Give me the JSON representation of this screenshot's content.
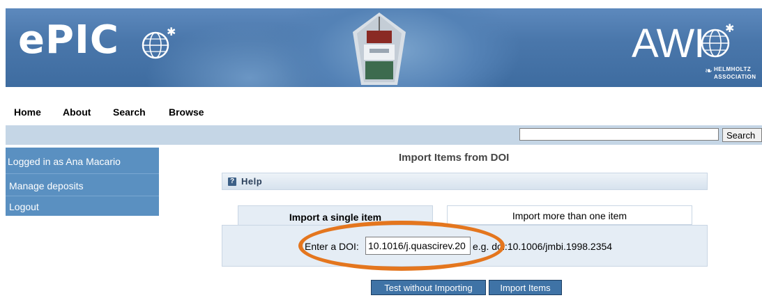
{
  "header": {
    "logo_left": "ePIC",
    "logo_right": "AWI",
    "association_line1": "HELMHOLTZ",
    "association_line2": "ASSOCIATION"
  },
  "nav": {
    "items": [
      "Home",
      "About",
      "Search",
      "Browse"
    ]
  },
  "search": {
    "value": "",
    "button_label": "Search"
  },
  "sidebar": {
    "logged_in": "Logged in as Ana Macario",
    "items": [
      "Manage deposits",
      "Logout"
    ]
  },
  "main": {
    "title": "Import Items from DOI",
    "help_label": "Help",
    "tabs": [
      {
        "label": "Import a single item",
        "active": true
      },
      {
        "label": "Import more than one item",
        "active": false
      }
    ],
    "doi_label": "Enter a DOI:",
    "doi_value": "10.1016/j.quascirev.20",
    "doi_example": "e.g. doi:10.1006/jmbi.1998.2354",
    "buttons": {
      "test": "Test without Importing",
      "import": "Import Items"
    }
  },
  "colors": {
    "highlight": "#e4761e",
    "sidebar": "#5a90c1",
    "button": "#3f73a6"
  }
}
